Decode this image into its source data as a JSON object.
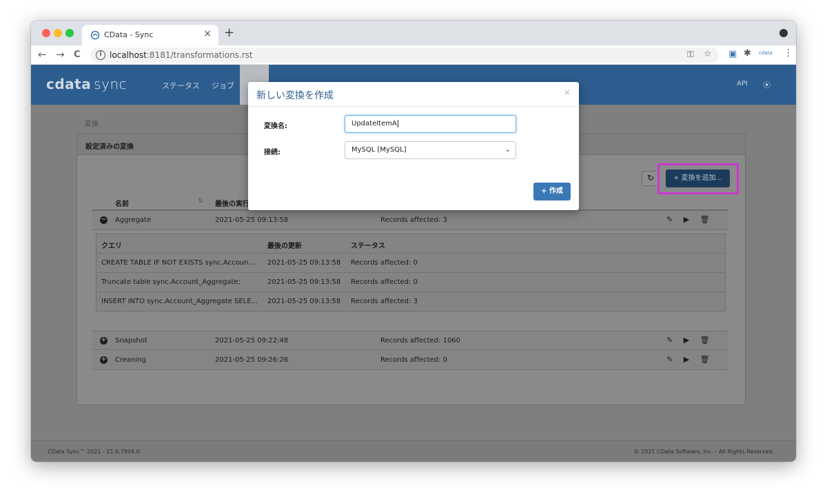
{
  "browser": {
    "tab_title": "CData - Sync",
    "tab_close": "×",
    "new_tab": "+",
    "url_host": "localhost",
    "url_rest": ":8181/transformations.rst",
    "back": "←",
    "forward": "→",
    "reload": "C"
  },
  "app": {
    "logo_brand": "cdata",
    "logo_product": "sync",
    "nav": [
      "ステータス",
      "ジョブ"
    ],
    "nav_api": "API",
    "nav_user": "⦿",
    "breadcrumb": "変換",
    "panel_title": "設定済みの変換",
    "add_button": "+ 変換を追加...",
    "refresh_icon": "↻",
    "table_headers": {
      "name": "名前",
      "last_run": "最後の実行"
    },
    "transformations": [
      {
        "name": "Aggregate",
        "last_run": "2021-05-25 09:13:58",
        "status": "Records affected: 3",
        "expanded": true,
        "toggle": "−"
      },
      {
        "name": "Snapshot",
        "last_run": "2021-05-25 09:22:48",
        "status": "Records affected: 1060",
        "expanded": false,
        "toggle": "+"
      },
      {
        "name": "Creaning",
        "last_run": "2021-05-25 09:26:26",
        "status": "Records affected: 0",
        "expanded": false,
        "toggle": "+"
      }
    ],
    "row_actions": "✎ ▶ 🗑",
    "query_headers": {
      "query": "クエリ",
      "updated": "最後の更新",
      "status": "ステータス"
    },
    "queries": [
      {
        "query": "CREATE TABLE IF NOT EXISTS sync.Accoun...",
        "updated": "2021-05-25 09:13:58",
        "status": "Records affected: 0"
      },
      {
        "query": "Truncate table sync.Account_Aggregate;",
        "updated": "2021-05-25 09:13:58",
        "status": "Records affected: 0"
      },
      {
        "query": "INSERT INTO sync.Account_Aggregate SELE...",
        "updated": "2021-05-25 09:13:58",
        "status": "Records affected: 3"
      }
    ],
    "footer_left": "CData Sync™ 2021 - 21.0.7804.0",
    "footer_right": "© 2021 CData Software, Inc. - All Rights Reserved."
  },
  "modal": {
    "title": "新しい変換を作成",
    "close": "×",
    "name_label": "変換名:",
    "name_value": "UpdateItemA",
    "connection_label": "接続:",
    "connection_value": "MySQL [MySQL]",
    "create_button": "+ 作成"
  },
  "colors": {
    "nav_bg": "#2d5d8f",
    "primary": "#3b79b6",
    "highlight": "#c93ad0"
  }
}
